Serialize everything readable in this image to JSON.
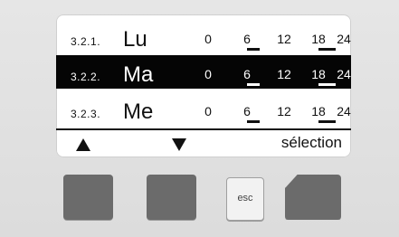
{
  "screen": {
    "rows": [
      {
        "code": "3.2.1.",
        "day": "Lu",
        "selected": false,
        "ticks": [
          "0",
          "6",
          "12",
          "18",
          "24"
        ],
        "bars": [
          [
            6,
            8
          ],
          [
            18,
            22
          ]
        ]
      },
      {
        "code": "3.2.2.",
        "day": "Ma",
        "selected": true,
        "ticks": [
          "0",
          "6",
          "12",
          "18",
          "24"
        ],
        "bars": [
          [
            6,
            8
          ],
          [
            18,
            22
          ]
        ]
      },
      {
        "code": "3.2.3.",
        "day": "Me",
        "selected": false,
        "ticks": [
          "0",
          "6",
          "12",
          "18",
          "24"
        ],
        "bars": [
          [
            6,
            8
          ],
          [
            18,
            22
          ]
        ]
      }
    ],
    "softkeys": {
      "up": "up-arrow",
      "down": "down-arrow",
      "right_label": "sélection"
    }
  },
  "buttons": {
    "esc_label": "esc"
  },
  "colors": {
    "screen_bg": "#ffffff",
    "selected_bg": "#050505",
    "button_gray": "#6b6b6b",
    "panel_bg": "#e3e3e3"
  }
}
